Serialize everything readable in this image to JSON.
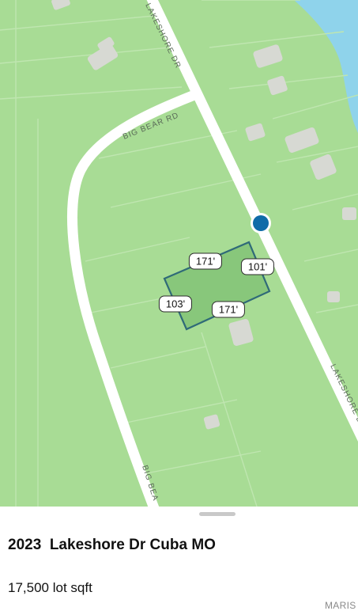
{
  "map": {
    "roads": {
      "lakeshore_top": "LAKESHORE DR",
      "lakeshore_bottom": "LAKESHORE D",
      "big_bear_top": "BIG BEAR RD",
      "big_bear_bottom": "BIG BEA"
    },
    "lot_dimensions": {
      "top": "171'",
      "right": "101'",
      "left": "103'",
      "bottom": "171'"
    },
    "colors": {
      "land": "#a8dc95",
      "water": "#8fd3eb",
      "road": "#ffffff",
      "lot_fill": "#88c77b",
      "lot_border": "#2f6a78",
      "pin": "#0f6ba8"
    }
  },
  "listing": {
    "address": "2023  Lakeshore Dr Cuba MO",
    "lot_size": "17,500 lot sqft"
  },
  "watermark": "MARIS"
}
